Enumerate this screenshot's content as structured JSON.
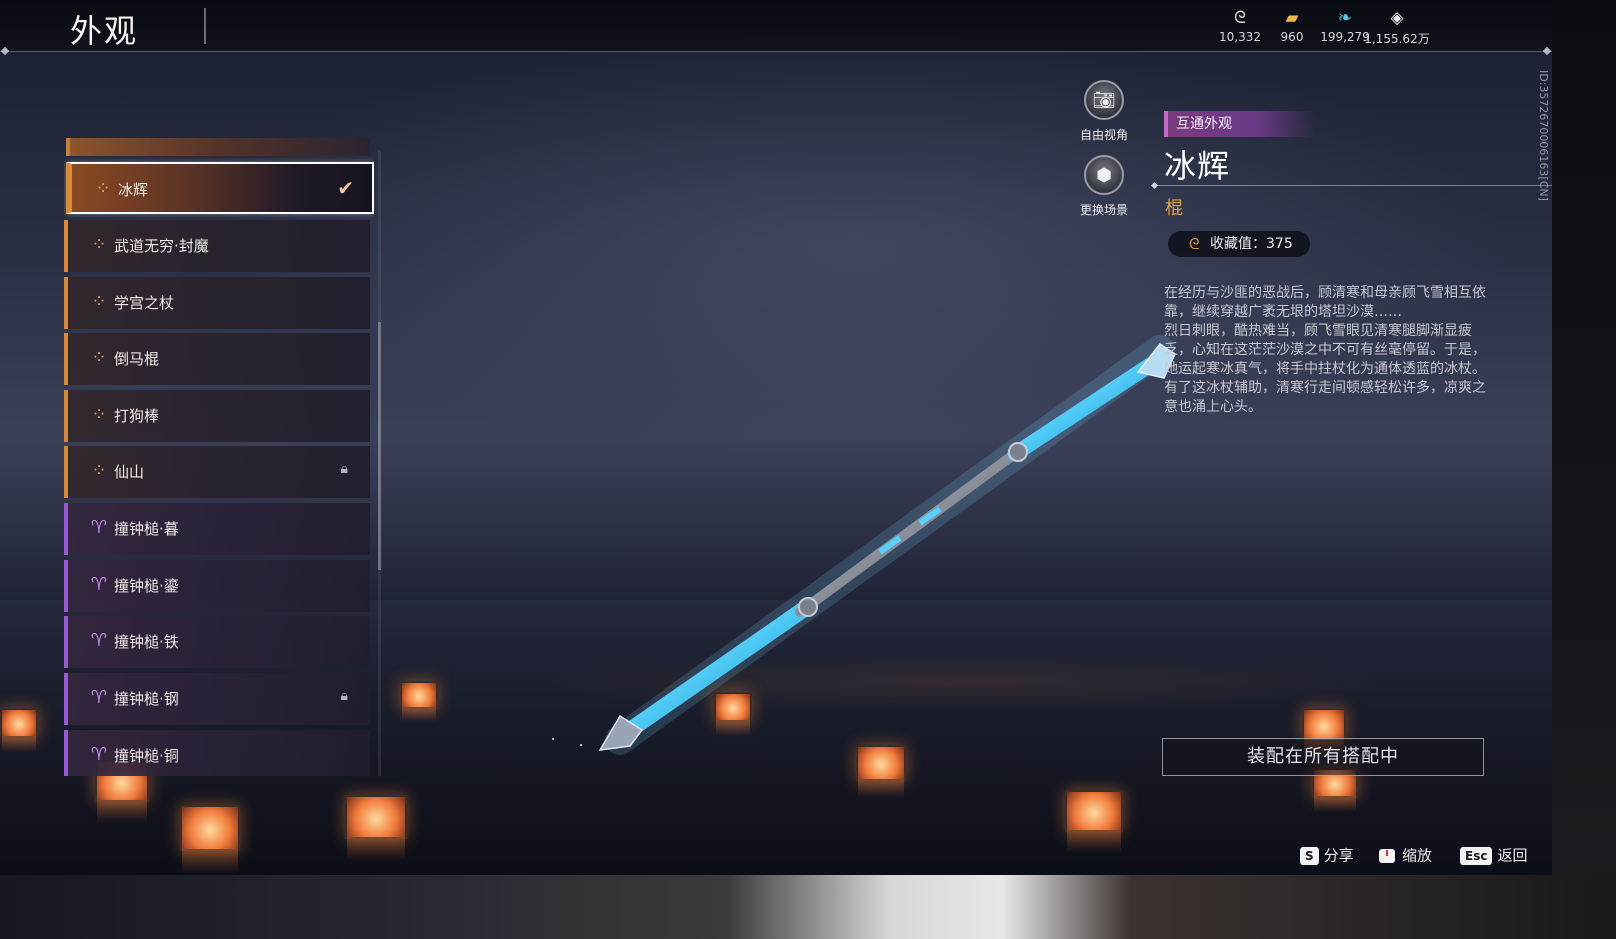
{
  "header": {
    "title": "外观",
    "currencies": [
      {
        "icon": "coin-swirl-icon",
        "value": "10,332"
      },
      {
        "icon": "gold-ingot-icon",
        "value": "960"
      },
      {
        "icon": "feather-icon",
        "value": "199,279"
      },
      {
        "icon": "diamond-icon",
        "value": "1,155.62万"
      }
    ]
  },
  "list": {
    "items": [
      {
        "label": "冰辉",
        "rarity": "orange",
        "state": "selected"
      },
      {
        "label": "武道无穷·封魔",
        "rarity": "orange"
      },
      {
        "label": "学宫之杖",
        "rarity": "orange"
      },
      {
        "label": "倒马棍",
        "rarity": "orange"
      },
      {
        "label": "打狗棒",
        "rarity": "orange"
      },
      {
        "label": "仙山",
        "rarity": "orange",
        "state": "locked"
      },
      {
        "label": "撞钟槌·暮",
        "rarity": "purple"
      },
      {
        "label": "撞钟槌·鎏",
        "rarity": "purple"
      },
      {
        "label": "撞钟槌·铁",
        "rarity": "purple"
      },
      {
        "label": "撞钟槌·钢",
        "rarity": "purple",
        "state": "locked"
      },
      {
        "label": "撞钟槌·铜",
        "rarity": "purple"
      }
    ]
  },
  "camera": {
    "free_view": "自由视角",
    "change_scene": "更换场景"
  },
  "detail": {
    "tag": "互通外观",
    "name": "冰辉",
    "type": "棍",
    "collection_label": "收藏值：",
    "collection_value": "375",
    "description": [
      "在经历与沙匪的恶战后，顾清寒和母亲顾飞雪相互依靠，继续穿越广袤无垠的塔坦沙漠……",
      "烈日刺眼，酷热难当，顾飞雪眼见清寒腿脚渐显疲乏，心知在这茫茫沙漠之中不可有丝毫停留。于是，她运起寒冰真气，将手中拄杖化为通体透蓝的冰杖。",
      "有了这冰杖辅助，清寒行走间顿感轻松许多，凉爽之意也涌上心头。"
    ],
    "equip_button": "装配在所有搭配中"
  },
  "side_id": "ID:3572670006163[CN]",
  "hints": [
    {
      "key": "S",
      "label": "分享"
    },
    {
      "key": "mouse-icon",
      "label": "缩放"
    },
    {
      "key": "Esc",
      "label": "返回"
    }
  ],
  "colors": {
    "orange_rarity": "#d8893a",
    "purple_rarity": "#9a5ad6",
    "type_gold": "#e0a04a",
    "tag_purple": "#7a3a7e"
  }
}
